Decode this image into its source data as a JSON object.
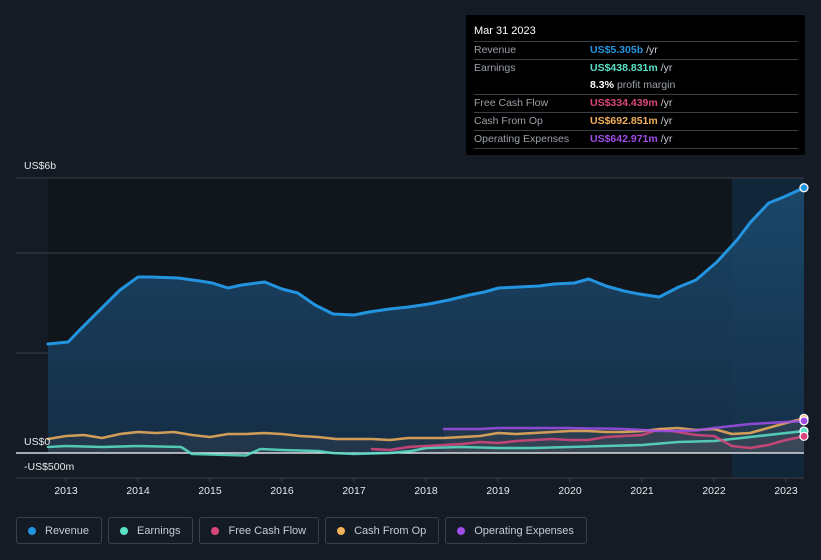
{
  "tooltip": {
    "date": "Mar 31 2023",
    "rows": [
      {
        "label": "Revenue",
        "value": "US$5.305b",
        "unit": "/yr",
        "color": "#2394df"
      },
      {
        "label": "Earnings",
        "value": "US$438.831m",
        "unit": "/yr",
        "color": "#5ae2c8"
      },
      {
        "label": "",
        "value": "8.3%",
        "unit": "profit margin"
      },
      {
        "label": "Free Cash Flow",
        "value": "US$334.439m",
        "unit": "/yr",
        "color": "#d9467c"
      },
      {
        "label": "Cash From Op",
        "value": "US$692.851m",
        "unit": "/yr",
        "color": "#f0b05c"
      },
      {
        "label": "Operating Expenses",
        "value": "US$642.971m",
        "unit": "/yr",
        "color": "#9f4de8"
      }
    ]
  },
  "legend": [
    {
      "label": "Revenue",
      "color": "#2394df"
    },
    {
      "label": "Earnings",
      "color": "#5ae2c8"
    },
    {
      "label": "Free Cash Flow",
      "color": "#d9467c"
    },
    {
      "label": "Cash From Op",
      "color": "#f0b05c"
    },
    {
      "label": "Operating Expenses",
      "color": "#9f4de8"
    }
  ],
  "chart_data": {
    "type": "area",
    "title": "",
    "xlabel": "",
    "ylabel": "",
    "y_tick_labels": [
      "US$6b",
      "US$0",
      "-US$500m"
    ],
    "x_tick_labels": [
      "2013",
      "2014",
      "2015",
      "2016",
      "2017",
      "2018",
      "2019",
      "2020",
      "2021",
      "2022",
      "2023"
    ],
    "xlim": [
      2012.75,
      2023.25
    ],
    "ylim": [
      -0.5,
      5.5
    ],
    "y_units": "billions USD",
    "gridlines": [
      0,
      2,
      4,
      5.5
    ],
    "highlight_from": 2022.25,
    "legend_position": "bottom",
    "series": [
      {
        "name": "Revenue",
        "color": "#2394df",
        "area": true,
        "x": [
          2012.75,
          2013.03,
          2013.19,
          2013.47,
          2013.75,
          2014.0,
          2014.17,
          2014.56,
          2014.86,
          2015.03,
          2015.25,
          2015.44,
          2015.76,
          2016.0,
          2016.22,
          2016.46,
          2016.71,
          2017.0,
          2017.21,
          2017.49,
          2017.76,
          2018.04,
          2018.32,
          2018.6,
          2018.81,
          2019.01,
          2019.29,
          2019.57,
          2019.78,
          2020.06,
          2020.26,
          2020.5,
          2020.75,
          2020.96,
          2021.24,
          2021.51,
          2021.75,
          2022.04,
          2022.32,
          2022.51,
          2022.76,
          2022.97,
          2023.25
        ],
        "y": [
          2.18,
          2.22,
          2.46,
          2.86,
          3.26,
          3.52,
          3.52,
          3.5,
          3.44,
          3.4,
          3.3,
          3.36,
          3.42,
          3.28,
          3.2,
          2.96,
          2.78,
          2.76,
          2.82,
          2.88,
          2.92,
          2.98,
          3.06,
          3.16,
          3.22,
          3.3,
          3.32,
          3.34,
          3.38,
          3.4,
          3.48,
          3.34,
          3.24,
          3.18,
          3.12,
          3.32,
          3.46,
          3.82,
          4.26,
          4.62,
          5.0,
          5.12,
          5.305
        ]
      },
      {
        "name": "Earnings",
        "color": "#5ae2c8",
        "x": [
          2012.75,
          2013.0,
          2013.5,
          2014.0,
          2014.6,
          2014.75,
          2015.0,
          2015.5,
          2015.7,
          2016.0,
          2016.5,
          2016.7,
          2017.0,
          2017.5,
          2017.8,
          2018.0,
          2018.5,
          2019.0,
          2019.5,
          2020.0,
          2020.5,
          2021.0,
          2021.5,
          2022.0,
          2022.5,
          2023.0,
          2023.25
        ],
        "y": [
          0.12,
          0.14,
          0.12,
          0.14,
          0.12,
          -0.02,
          -0.03,
          -0.05,
          0.08,
          0.06,
          0.04,
          0.0,
          -0.02,
          0.0,
          0.04,
          0.1,
          0.12,
          0.1,
          0.1,
          0.12,
          0.14,
          0.16,
          0.22,
          0.24,
          0.32,
          0.4,
          0.439
        ]
      },
      {
        "name": "Free Cash Flow",
        "color": "#d9467c",
        "x": [
          2017.25,
          2017.5,
          2017.75,
          2018.0,
          2018.25,
          2018.5,
          2018.75,
          2019.0,
          2019.25,
          2019.5,
          2019.75,
          2020.0,
          2020.25,
          2020.5,
          2020.75,
          2021.0,
          2021.25,
          2021.5,
          2021.75,
          2022.0,
          2022.25,
          2022.5,
          2022.75,
          2023.0,
          2023.25
        ],
        "y": [
          0.08,
          0.06,
          0.12,
          0.14,
          0.16,
          0.18,
          0.22,
          0.2,
          0.24,
          0.26,
          0.28,
          0.26,
          0.26,
          0.32,
          0.34,
          0.36,
          0.48,
          0.42,
          0.36,
          0.34,
          0.14,
          0.1,
          0.16,
          0.26,
          0.334
        ]
      },
      {
        "name": "Cash From Op",
        "color": "#f0b05c",
        "x": [
          2012.75,
          2013.0,
          2013.25,
          2013.5,
          2013.75,
          2014.0,
          2014.25,
          2014.5,
          2014.75,
          2015.0,
          2015.25,
          2015.5,
          2015.75,
          2016.0,
          2016.25,
          2016.5,
          2016.75,
          2017.0,
          2017.25,
          2017.5,
          2017.75,
          2018.0,
          2018.25,
          2018.5,
          2018.75,
          2019.0,
          2019.25,
          2019.5,
          2019.75,
          2020.0,
          2020.25,
          2020.5,
          2020.75,
          2021.0,
          2021.25,
          2021.5,
          2021.75,
          2022.0,
          2022.25,
          2022.5,
          2022.75,
          2023.0,
          2023.25
        ],
        "y": [
          0.28,
          0.34,
          0.36,
          0.3,
          0.38,
          0.42,
          0.4,
          0.42,
          0.36,
          0.32,
          0.38,
          0.38,
          0.4,
          0.38,
          0.34,
          0.32,
          0.28,
          0.28,
          0.28,
          0.26,
          0.3,
          0.3,
          0.3,
          0.32,
          0.34,
          0.4,
          0.38,
          0.4,
          0.42,
          0.44,
          0.44,
          0.42,
          0.42,
          0.44,
          0.48,
          0.5,
          0.46,
          0.48,
          0.38,
          0.4,
          0.5,
          0.6,
          0.693
        ]
      },
      {
        "name": "Operating Expenses",
        "color": "#9f4de8",
        "x": [
          2018.25,
          2018.5,
          2018.75,
          2019.0,
          2019.25,
          2019.5,
          2019.75,
          2020.0,
          2020.25,
          2020.5,
          2020.75,
          2021.0,
          2021.25,
          2021.5,
          2021.75,
          2022.0,
          2022.25,
          2022.5,
          2022.75,
          2023.0,
          2023.25
        ],
        "y": [
          0.48,
          0.48,
          0.48,
          0.5,
          0.5,
          0.5,
          0.5,
          0.5,
          0.49,
          0.49,
          0.48,
          0.46,
          0.44,
          0.44,
          0.45,
          0.5,
          0.54,
          0.58,
          0.6,
          0.62,
          0.643
        ]
      }
    ]
  }
}
